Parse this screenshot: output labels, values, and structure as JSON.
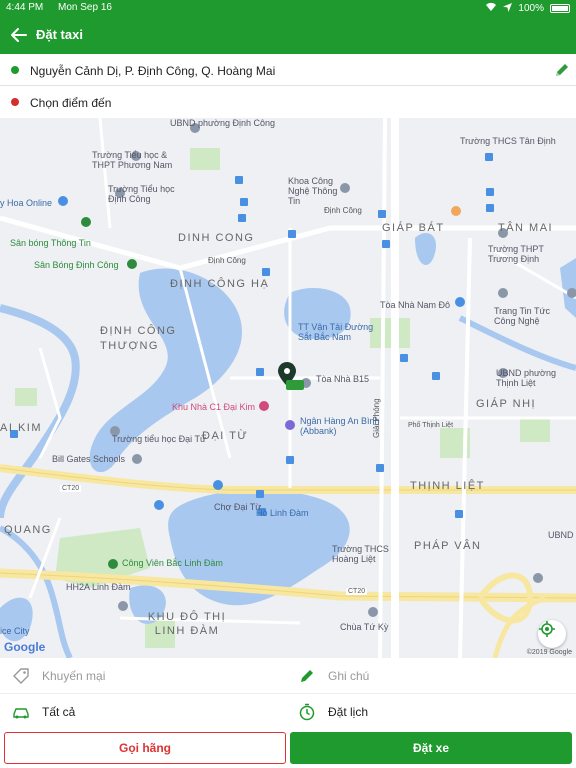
{
  "status_bar": {
    "time": "4:44 PM",
    "date": "Mon Sep 16",
    "battery": "100%"
  },
  "header": {
    "title": "Đặt taxi"
  },
  "pickup": {
    "address": "Nguyễn Cảnh Dị, P. Định Công, Q. Hoàng Mai"
  },
  "destination": {
    "placeholder": "Chọn điểm đến"
  },
  "map": {
    "labels": {
      "ubnd_dinh_cong": "UBND phường Định Công",
      "truong_th_phuong_nam": "Trường Tiểu học & THPT Phương Nam",
      "truong_th_dinh_cong": "Trường Tiểu học Định Công",
      "hoa_online": "y Hoa Online",
      "khoa_cong_nghe": "Khoa Công Nghệ Thông Tin",
      "dinh_cong_road": "Định Công",
      "truong_thcs_tan_dinh": "Trường THCS Tân Định",
      "giap_bat": "GIÁP BÁT",
      "tan_mai": "TÂN MAI",
      "truong_thpt_truong_dinh": "Trường THPT Trương Định",
      "san_bong_thong_tin": "Sân bóng Thông Tin",
      "san_bong_dinh_cong": "Sân Bóng Định Công",
      "dinh_cong_district": "DINH CONG",
      "dinh_cong_road2": "Định Công",
      "dinh_cong_ha": "ĐỊNH CÔNG HẠ",
      "hoa_nha_nam_do": "Tòa Nhà Nam Đô",
      "trang_tin_tuc": "Trang Tin Tức Công Nghệ",
      "dinh_cong_thuong": "ĐỊNH CÔNG THƯỢNG",
      "tt_van_tai": "TT Vận Tải Đường Sắt Bắc Nam",
      "toa_nha_b15": "Tòa Nhà B15",
      "ubnd_thinh_liet": "UBND phường Thịnh Liệt",
      "khu_nha_c1": "Khu Nhà C1 Đại Kim",
      "giap_nhi": "GIÁP NHỊ",
      "dai_kim": "AI KIM",
      "ngan_hang": "Ngân Hàng An Bình (Abbank)",
      "truong_th_dai_tu": "Trường tiểu học Đại Từ",
      "bill_gates": "Bill Gates Schools",
      "dai_tu": "ĐẠI TỪ",
      "giai_phong": "Giải Phóng",
      "pho_thinh_liet": "Phố Thịnh Liệt",
      "ct20": "CT20",
      "cho_dai_tu": "Chợ Đại Từ",
      "thinh_liet": "THỊNH LIỆT",
      "ho_linh_dam": "Hồ Linh Đàm",
      "quang": "QUANG",
      "phap_van": "PHÁP VÂN",
      "cong_vien": "Công Viên Bắc Linh Đàm",
      "truong_thcs_hoang_liet": "Trường THCS Hoàng Liệt",
      "hh2a": "HH2A Linh Đàm",
      "ct20_b": "CT20",
      "khu_do_thi": "KHU ĐÔ THỊ LINH ĐÀM",
      "chua_tu_ky": "Chùa Tứ Kỳ",
      "ice_city": "ice City",
      "ubnd_right": "UBND"
    },
    "copyright": "©2019 Google",
    "logo": "Google"
  },
  "options": {
    "promo": "Khuyến mại",
    "note": "Ghi chú",
    "car_type": "Tất cả",
    "schedule": "Đặt lịch"
  },
  "actions": {
    "call_label": "Gọi hãng",
    "book_label": "Đặt xe"
  },
  "colors": {
    "primary": "#1f9a2e",
    "danger": "#d33333",
    "pickup_dot": "#1f9a2e",
    "dest_dot": "#d32f2f"
  }
}
